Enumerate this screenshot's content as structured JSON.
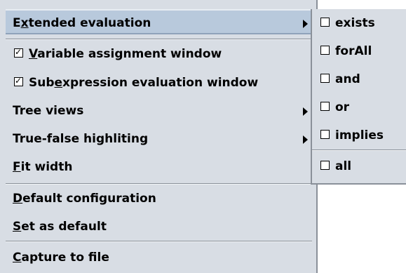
{
  "menu": {
    "extended_evaluation": {
      "before": "E",
      "mnemonic": "x",
      "after": "tended evaluation"
    },
    "variable_assignment": {
      "before": "",
      "mnemonic": "V",
      "after": "ariable assignment window",
      "checked": true
    },
    "subexpression_evaluation": {
      "before": "Sub",
      "mnemonic": "e",
      "after": "xpression evaluation window",
      "checked": true
    },
    "tree_views": {
      "label": "Tree views"
    },
    "true_false_highliting": {
      "label": "True-false highliting"
    },
    "fit_width": {
      "before": "",
      "mnemonic": "F",
      "after": "it width"
    },
    "default_configuration": {
      "before": "",
      "mnemonic": "D",
      "after": "efault configuration"
    },
    "set_as_default": {
      "before": "",
      "mnemonic": "S",
      "after": "et as default"
    },
    "capture_to_file": {
      "before": "",
      "mnemonic": "C",
      "after": "apture to file"
    }
  },
  "submenu": {
    "items": [
      {
        "label": "exists",
        "checked": false
      },
      {
        "label": "forAll",
        "checked": false
      },
      {
        "label": "and",
        "checked": false
      },
      {
        "label": "or",
        "checked": false
      },
      {
        "label": "implies",
        "checked": false
      }
    ],
    "all": {
      "label": "all",
      "checked": false
    }
  },
  "colors": {
    "menu_background": "#d8dde4",
    "selected_background": "#b8c9dc",
    "separator": "#8a9099"
  }
}
